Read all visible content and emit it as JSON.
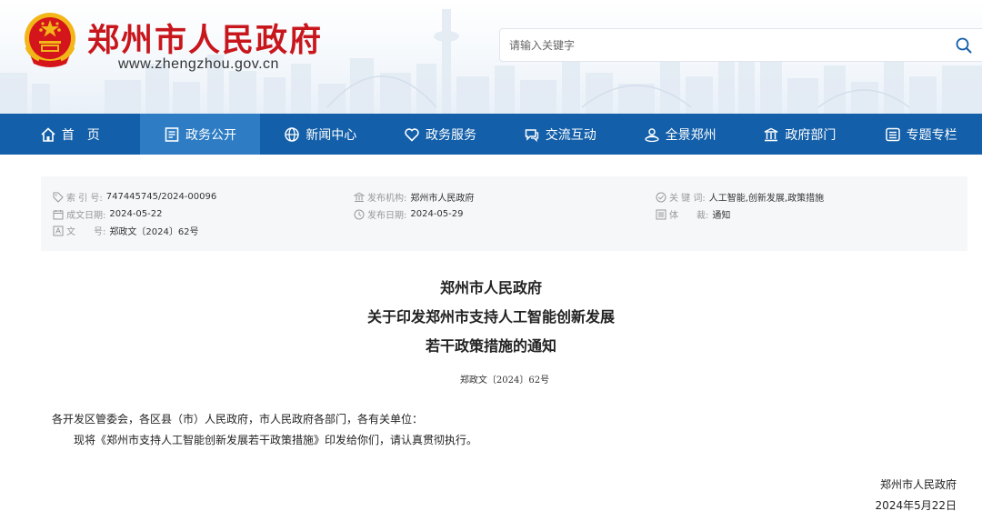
{
  "header": {
    "site_title": "郑州市人民政府",
    "site_url": "www.zhengzhou.gov.cn",
    "search_placeholder": "请输入关键字"
  },
  "nav": {
    "items": [
      {
        "label": "首　页",
        "icon": "home-icon"
      },
      {
        "label": "政务公开",
        "icon": "document-icon"
      },
      {
        "label": "新闻中心",
        "icon": "globe-icon"
      },
      {
        "label": "政务服务",
        "icon": "heart-icon"
      },
      {
        "label": "交流互动",
        "icon": "chat-icon"
      },
      {
        "label": "全景郑州",
        "icon": "panorama-icon"
      },
      {
        "label": "政府部门",
        "icon": "building-icon"
      },
      {
        "label": "专题专栏",
        "icon": "list-icon"
      }
    ],
    "active_index": 1
  },
  "meta": {
    "index_label": "索 引 号:",
    "index_value": "747445745/2024-00096",
    "issuer_label": "发布机构:",
    "issuer_value": "郑州市人民政府",
    "keywords_label": "关 键 词:",
    "keywords_value": "人工智能,创新发展,政策措施",
    "written_label": "成文日期:",
    "written_value": "2024-05-22",
    "published_label": "发布日期:",
    "published_value": "2024-05-29",
    "genre_label": "体　　裁:",
    "genre_value": "通知",
    "docno_label": "文　　号:",
    "docno_value": "郑政文〔2024〕62号"
  },
  "document": {
    "title_line1": "郑州市人民政府",
    "title_line2": "关于印发郑州市支持人工智能创新发展",
    "title_line3": "若干政策措施的通知",
    "doc_number": "郑政文〔2024〕62号",
    "salutation": "各开发区管委会，各区县（市）人民政府，市人民政府各部门，各有关单位：",
    "paragraph": "现将《郑州市支持人工智能创新发展若干政策措施》印发给你们，请认真贯彻执行。",
    "signature": "郑州市人民政府",
    "date": "2024年5月22日"
  },
  "colors": {
    "brand_red": "#c8161d",
    "nav_blue": "#135fa9",
    "nav_active": "#2d7cc4"
  }
}
